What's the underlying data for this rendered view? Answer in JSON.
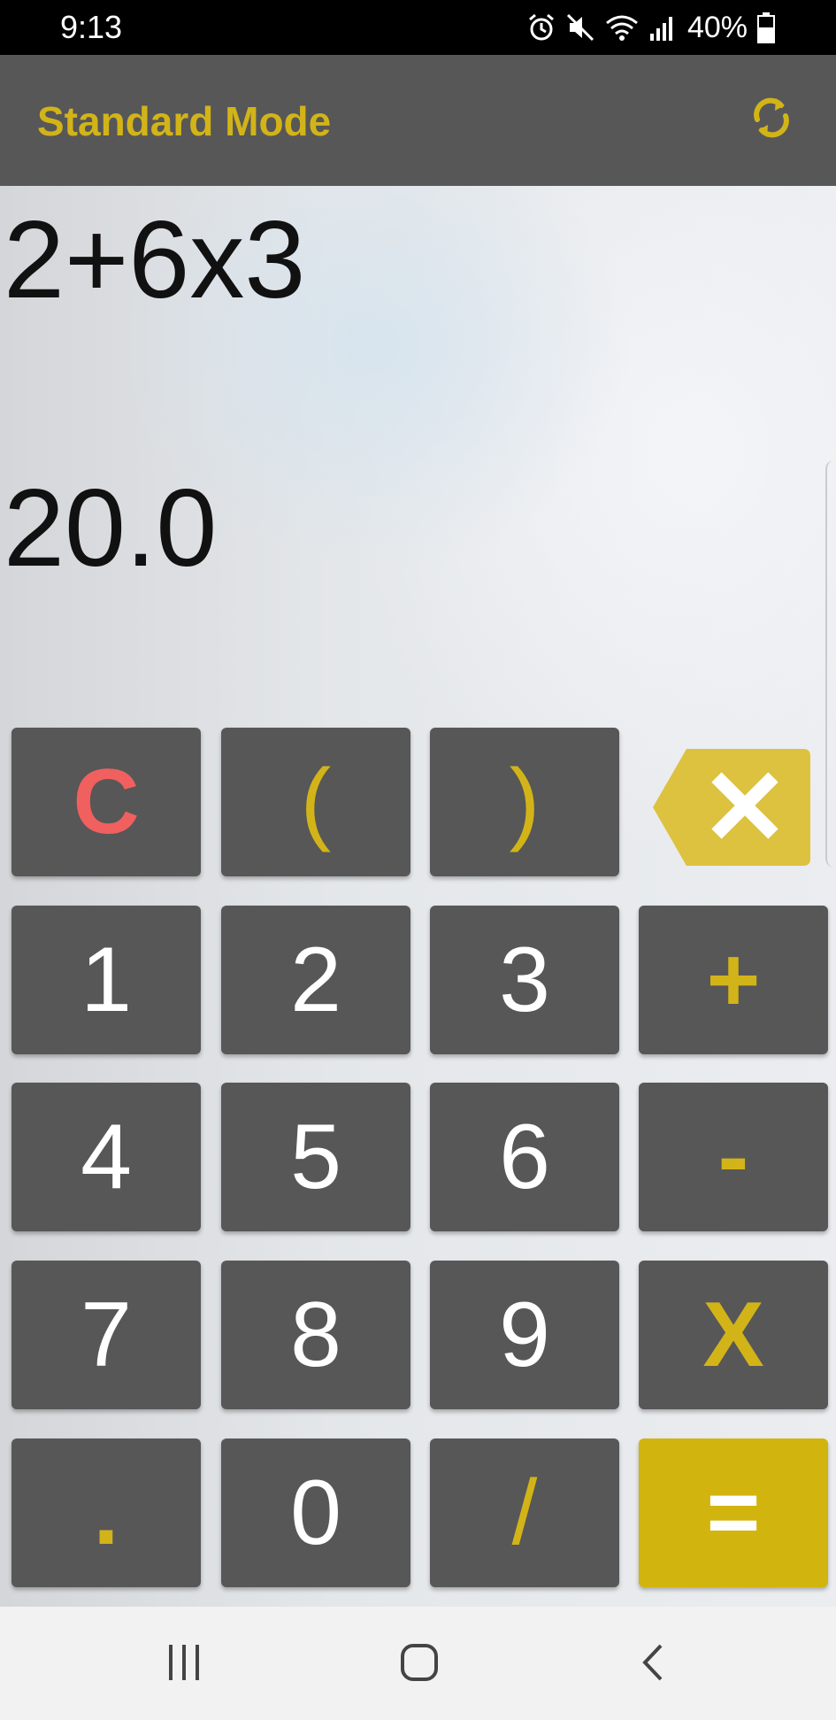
{
  "status_bar": {
    "time": "9:13",
    "battery": "40%",
    "icons": [
      "alarm-icon",
      "mute-icon",
      "wifi-icon",
      "signal-icon",
      "battery-icon"
    ]
  },
  "app_bar": {
    "title": "Standard Mode",
    "toggle_icon": "refresh-icon"
  },
  "display": {
    "expression": "2+6x3",
    "result": "20.0"
  },
  "keypad": {
    "clear": "C",
    "open_paren": "(",
    "close_paren": ")",
    "backspace_icon": "backspace-icon",
    "one": "1",
    "two": "2",
    "three": "3",
    "plus": "+",
    "four": "4",
    "five": "5",
    "six": "6",
    "minus": "-",
    "seven": "7",
    "eight": "8",
    "nine": "9",
    "multiply": "X",
    "decimal": ".",
    "zero": "0",
    "divide": "/",
    "equals": "="
  },
  "nav_bar": {
    "icons": [
      "recent-apps-icon",
      "home-icon",
      "back-icon"
    ]
  },
  "colors": {
    "accent": "#d2b419",
    "key_bg": "#575757",
    "clear": "#f0605f",
    "equals_bg": "#d2b40f"
  }
}
